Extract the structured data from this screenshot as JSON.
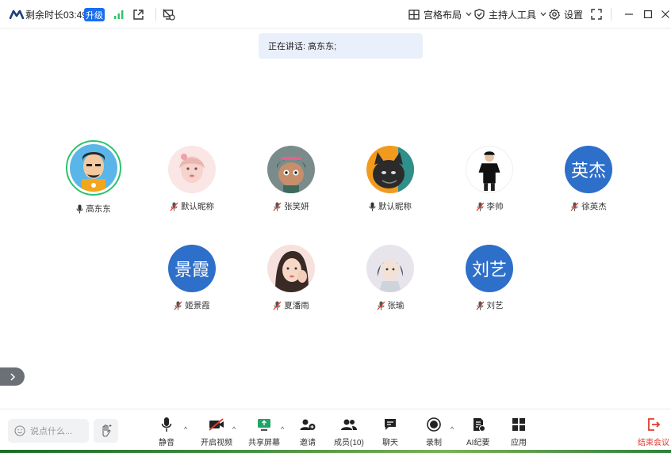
{
  "topbar": {
    "timer": "剩余时长03:49",
    "upgrade": "升级",
    "layout_label": "宫格布局",
    "host_tools_label": "主持人工具",
    "settings_label": "设置"
  },
  "speaking": {
    "text": "正在讲话: 高东东;"
  },
  "participants": [
    {
      "name": "高东东",
      "mic": "on",
      "avatar": "photo-cartoon-man",
      "speaking": true
    },
    {
      "name": "默认昵称",
      "mic": "muted",
      "avatar": "photo-girl-pink"
    },
    {
      "name": "张笑妍",
      "mic": "muted",
      "avatar": "photo-cartoon-girl"
    },
    {
      "name": "默认昵称",
      "mic": "on",
      "avatar": "photo-black-cat"
    },
    {
      "name": "李帅",
      "mic": "muted",
      "avatar": "photo-man-black-tshirt"
    },
    {
      "name": "徐英杰",
      "mic": "muted",
      "avatar_text": "英杰"
    },
    {
      "name": "姬景霞",
      "mic": "muted",
      "avatar_text": "景霞"
    },
    {
      "name": "夏潘雨",
      "mic": "muted",
      "avatar": "photo-woman-selfie"
    },
    {
      "name": "张瑜",
      "mic": "muted",
      "avatar": "photo-anime-man"
    },
    {
      "name": "刘艺",
      "mic": "muted",
      "avatar_text": "刘艺"
    }
  ],
  "bottombar": {
    "chat_placeholder": "说点什么...",
    "mute_label": "静音",
    "video_label": "开启视频",
    "share_label": "共享屏幕",
    "invite_label": "邀请",
    "members_label": "成员(10)",
    "chat_label": "聊天",
    "record_label": "录制",
    "ai_label": "AI纪要",
    "apps_label": "应用",
    "end_label": "结束会议"
  },
  "colors": {
    "accent": "#1a6df0",
    "speaking_ring": "#2dc36a",
    "text_avatar": "#2d6fc9",
    "end": "#e23b2e",
    "share_green": "#1fa566"
  }
}
